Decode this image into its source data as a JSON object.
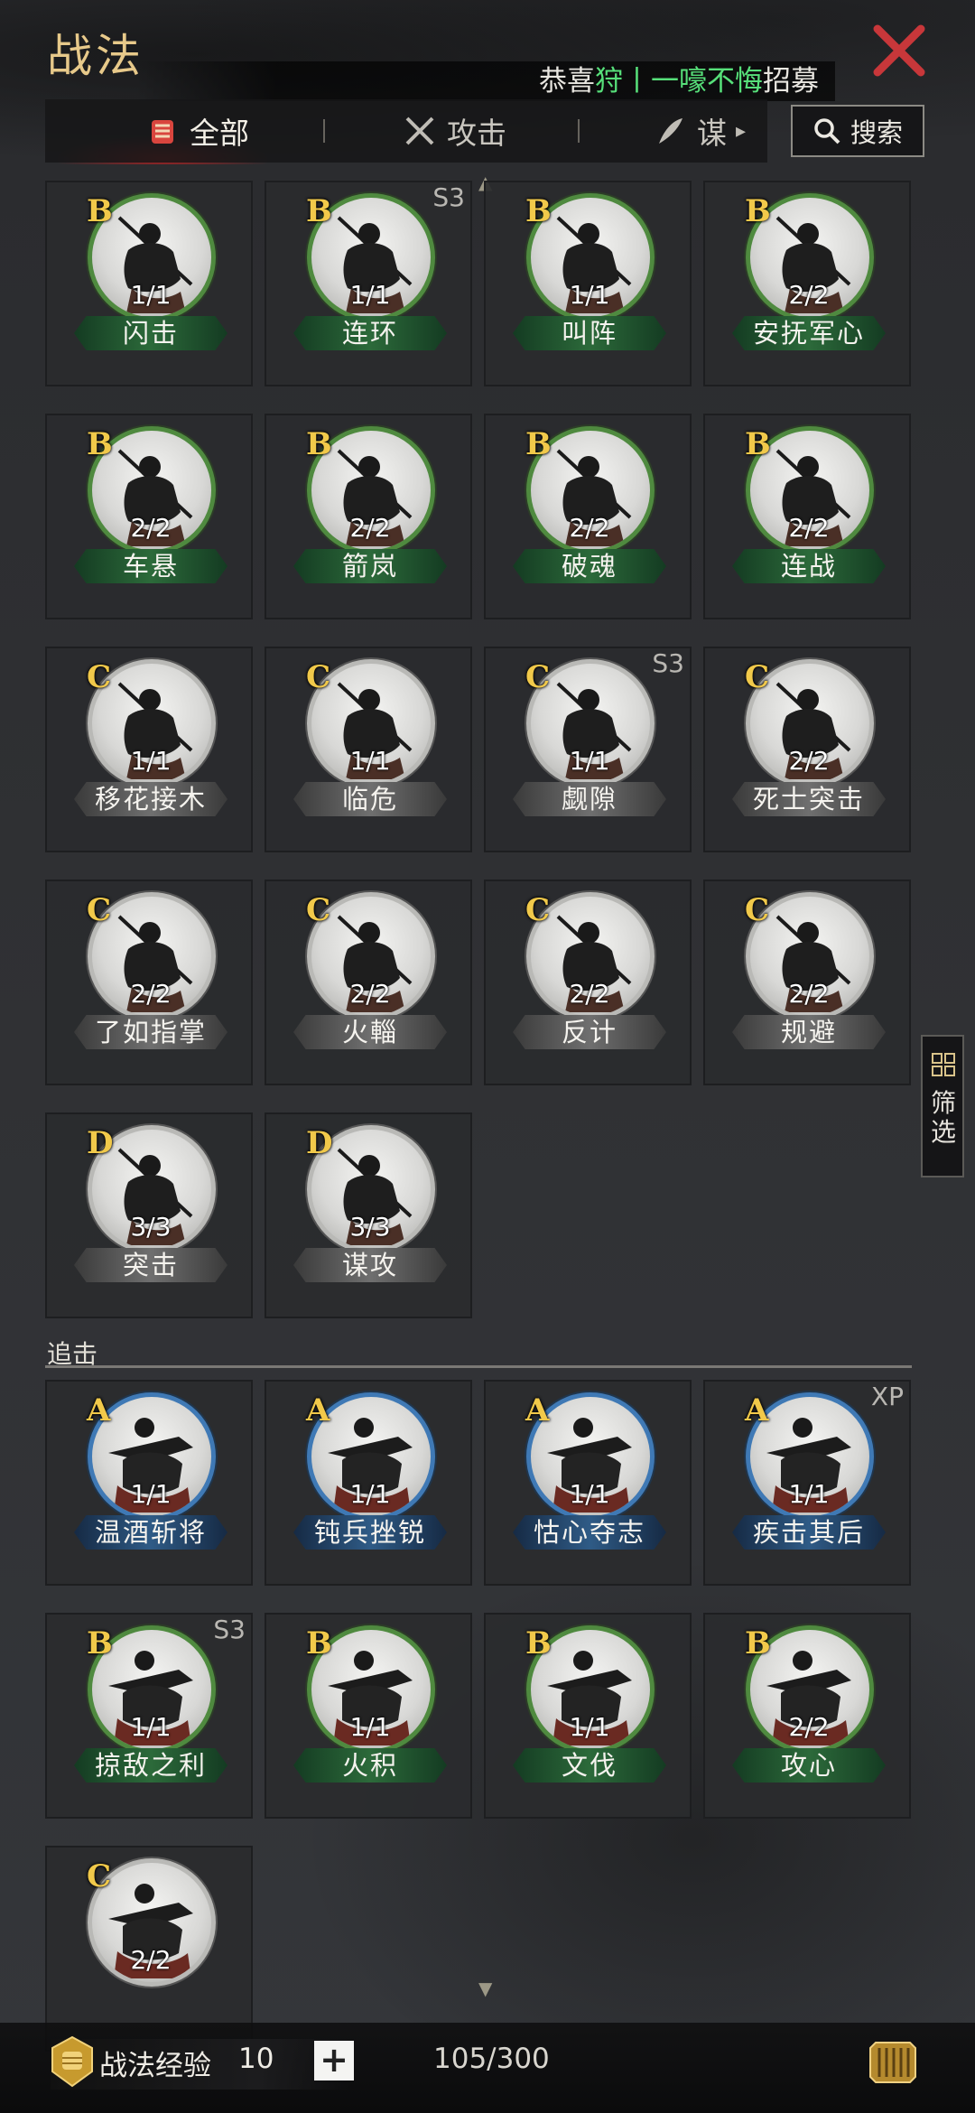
{
  "header": {
    "title": "战法",
    "ticker": {
      "prefix": "恭喜",
      "name": "狩",
      "separator": "丨",
      "skill": "一嚎不悔",
      "suffix": "招募"
    },
    "close_icon": "close-x-icon",
    "accent_color": "#e7c98a",
    "close_color": "#c8373a"
  },
  "tabs": [
    {
      "label": "全部",
      "icon": "all-scroll-icon",
      "active": true
    },
    {
      "label": "攻击",
      "icon": "crossed-swords-icon",
      "active": false
    },
    {
      "label": "谋",
      "icon": "strategy-feather-icon",
      "active": false
    }
  ],
  "search": {
    "label": "搜索",
    "icon": "search-icon"
  },
  "filter": {
    "label": "筛选",
    "icon": "grid-icon"
  },
  "cards": [
    {
      "grade": "B",
      "count": "1/1",
      "name": "闪击",
      "season": "",
      "tier": "green",
      "art": "spear"
    },
    {
      "grade": "B",
      "count": "1/1",
      "name": "连环",
      "season": "S3",
      "tier": "green",
      "art": "spear"
    },
    {
      "grade": "B",
      "count": "1/1",
      "name": "叫阵",
      "season": "",
      "tier": "green",
      "art": "spear"
    },
    {
      "grade": "B",
      "count": "2/2",
      "name": "安抚军心",
      "season": "",
      "tier": "green",
      "art": "spear"
    },
    {
      "grade": "B",
      "count": "2/2",
      "name": "车悬",
      "season": "",
      "tier": "green",
      "art": "spear"
    },
    {
      "grade": "B",
      "count": "2/2",
      "name": "箭岚",
      "season": "",
      "tier": "green",
      "art": "spear"
    },
    {
      "grade": "B",
      "count": "2/2",
      "name": "破魂",
      "season": "",
      "tier": "green",
      "art": "spear"
    },
    {
      "grade": "B",
      "count": "2/2",
      "name": "连战",
      "season": "",
      "tier": "green",
      "art": "spear"
    },
    {
      "grade": "C",
      "count": "1/1",
      "name": "移花接木",
      "season": "",
      "tier": "gray",
      "art": "spear"
    },
    {
      "grade": "C",
      "count": "1/1",
      "name": "临危",
      "season": "",
      "tier": "gray",
      "art": "spear"
    },
    {
      "grade": "C",
      "count": "1/1",
      "name": "觑隙",
      "season": "S3",
      "tier": "gray",
      "art": "spear"
    },
    {
      "grade": "C",
      "count": "2/2",
      "name": "死士突击",
      "season": "",
      "tier": "gray",
      "art": "spear"
    },
    {
      "grade": "C",
      "count": "2/2",
      "name": "了如指掌",
      "season": "",
      "tier": "gray",
      "art": "spear"
    },
    {
      "grade": "C",
      "count": "2/2",
      "name": "火輜",
      "season": "",
      "tier": "gray",
      "art": "spear"
    },
    {
      "grade": "C",
      "count": "2/2",
      "name": "反计",
      "season": "",
      "tier": "gray",
      "art": "spear"
    },
    {
      "grade": "C",
      "count": "2/2",
      "name": "规避",
      "season": "",
      "tier": "gray",
      "art": "spear"
    },
    {
      "grade": "D",
      "count": "3/3",
      "name": "突击",
      "season": "",
      "tier": "gray",
      "art": "spear"
    },
    {
      "grade": "D",
      "count": "3/3",
      "name": "谋攻",
      "season": "",
      "tier": "gray",
      "art": "spear"
    }
  ],
  "section_pursuit": {
    "label": "追击",
    "cards": [
      {
        "grade": "A",
        "count": "1/1",
        "name": "温酒斩将",
        "season": "",
        "tier": "blue",
        "art": "rider"
      },
      {
        "grade": "A",
        "count": "1/1",
        "name": "钝兵挫锐",
        "season": "",
        "tier": "blue",
        "art": "rider"
      },
      {
        "grade": "A",
        "count": "1/1",
        "name": "怙心夺志",
        "season": "",
        "tier": "blue",
        "art": "rider"
      },
      {
        "grade": "A",
        "count": "1/1",
        "name": "疾击其后",
        "season": "XP",
        "tier": "blue",
        "art": "rider"
      },
      {
        "grade": "B",
        "count": "1/1",
        "name": "掠敌之利",
        "season": "S3",
        "tier": "green",
        "art": "rider"
      },
      {
        "grade": "B",
        "count": "1/1",
        "name": "火积",
        "season": "",
        "tier": "green",
        "art": "rider"
      },
      {
        "grade": "B",
        "count": "1/1",
        "name": "文伐",
        "season": "",
        "tier": "green",
        "art": "rider"
      },
      {
        "grade": "B",
        "count": "2/2",
        "name": "攻心",
        "season": "",
        "tier": "green",
        "art": "rider"
      },
      {
        "grade": "C",
        "count": "2/2",
        "name": "",
        "season": "",
        "tier": "gray",
        "art": "rider"
      }
    ]
  },
  "footer": {
    "exp_label": "战法经验",
    "exp_value": "10",
    "plus_label": "+",
    "progress": "105/300",
    "exp_icon": "fist-medal-icon",
    "bag_icon": "scroll-bag-icon"
  }
}
